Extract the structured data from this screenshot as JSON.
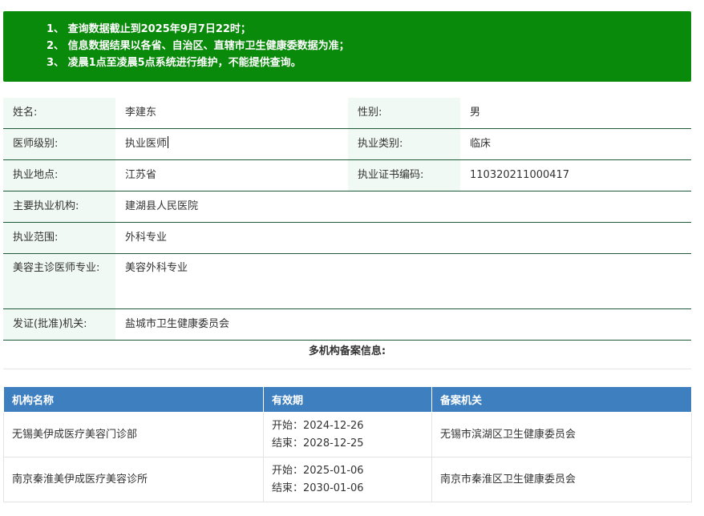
{
  "notice": {
    "lines": [
      "1、 查询数据截止到2025年9月7日22时；",
      "2、 信息数据结果以各省、自治区、直辖市卫生健康委数据为准；",
      "3、 凌晨1点至凌晨5点系统进行维护，不能提供查询。"
    ],
    "bg_color": "#0a8a0a"
  },
  "doctor": {
    "name_label": "姓名:",
    "name": "李建东",
    "gender_label": "性别:",
    "gender": "男",
    "level_label": "医师级别:",
    "level": "执业医师",
    "category_label": "执业类别:",
    "category": "临床",
    "location_label": "执业地点:",
    "location": "江苏省",
    "cert_label": "执业证书编码:",
    "cert": "110320211000417",
    "institution_label": "主要执业机构:",
    "institution": "建湖县人民医院",
    "scope_label": "执业范围:",
    "scope": "外科专业",
    "cosmetic_label": "美容主诊医师专业:",
    "cosmetic": "美容外科专业",
    "issuer_label": "发证(批准)机关:",
    "issuer": "盐城市卫生健康委员会"
  },
  "multi": {
    "title": "多机构备案信息:",
    "headers": [
      "机构名称",
      "有效期",
      "备案机关"
    ],
    "header_color": "#3d7fbf",
    "rows": [
      {
        "name": "无锡美伊成医疗美容门诊部",
        "start": "开始：2024-12-26",
        "end": "结束：2028-12-25",
        "authority": "无锡市滨湖区卫生健康委员会"
      },
      {
        "name": "南京秦淮美伊成医疗美容诊所",
        "start": "开始：2025-01-06",
        "end": "结束：2030-01-06",
        "authority": "南京市秦淮区卫生健康委员会"
      }
    ]
  }
}
